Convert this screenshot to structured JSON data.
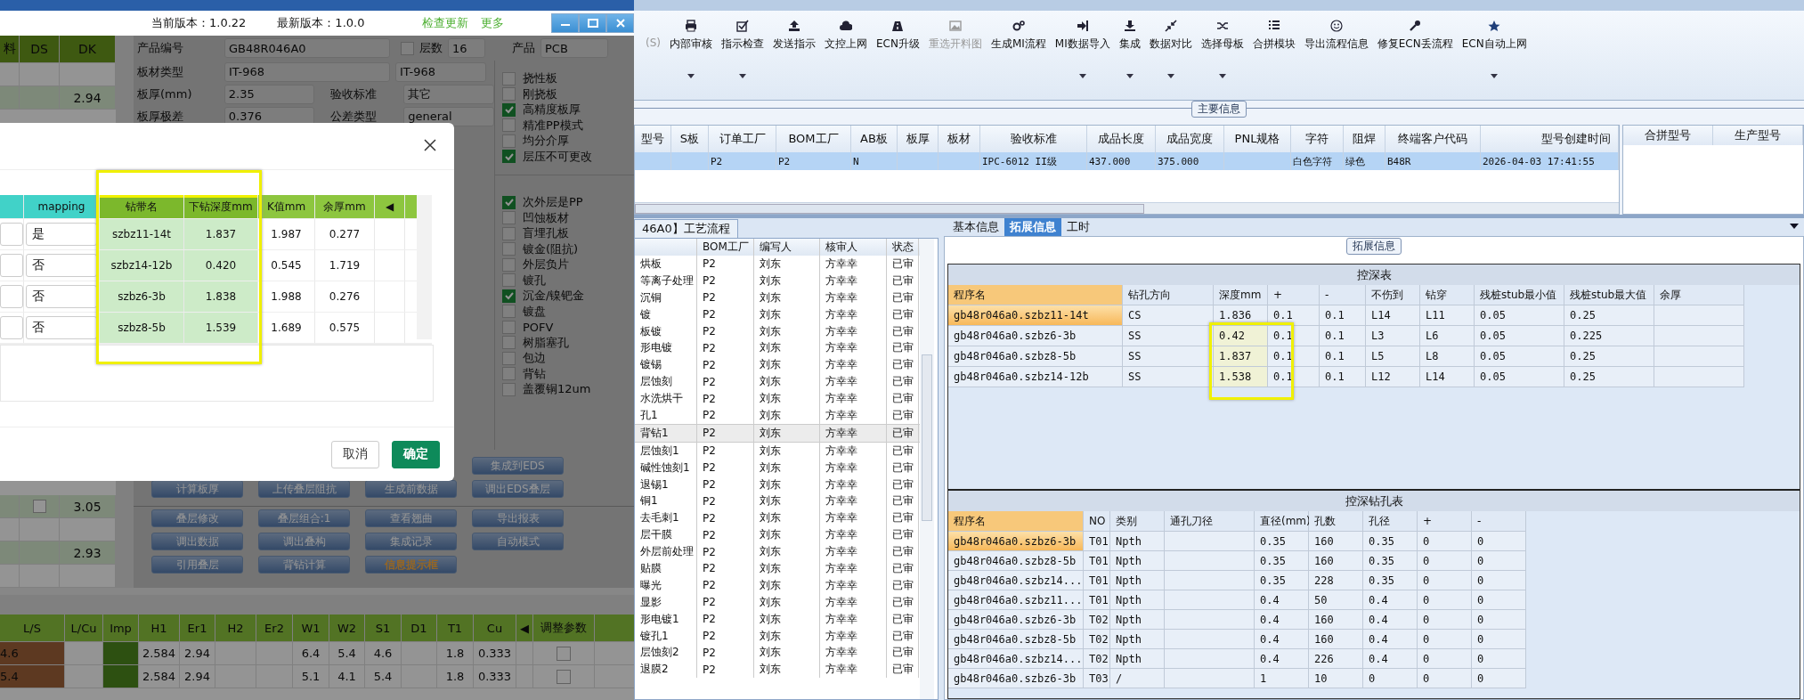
{
  "left_window": {
    "header": {
      "current_version": "当前版本：1.0.22",
      "latest_version": "最新版本：1.0.0",
      "links": [
        "检查更新",
        "更多"
      ]
    },
    "stack_table": {
      "columns": [
        "料",
        "DS",
        "DK"
      ],
      "rows_above": [
        {
          "cells": [
            "",
            "",
            ""
          ],
          "highlighted": false
        },
        {
          "cells": [
            "",
            "",
            "2.94"
          ],
          "highlighted": true
        }
      ],
      "rows_below": [
        {
          "cells": [
            "",
            "",
            "3.05"
          ],
          "highlighted": true,
          "checkbox": true
        },
        {
          "cells": [
            "",
            "",
            ""
          ],
          "highlighted": false,
          "checkbox": false
        },
        {
          "cells": [
            "",
            "",
            "2.93"
          ],
          "highlighted": true,
          "checkbox": false
        },
        {
          "cells": [
            "",
            "",
            ""
          ],
          "highlighted": false,
          "checkbox": false
        }
      ]
    },
    "form": {
      "row1": [
        {
          "label": "产品编号",
          "value": "GB48R046A0"
        },
        {
          "label": "层数",
          "value": "16",
          "checked": false
        },
        {
          "label": "产品",
          "value": "PCB"
        }
      ],
      "rows": [
        {
          "label": "板材类型",
          "value": "IT-968",
          "label2": "",
          "value2": "IT-968"
        },
        {
          "label": "板厚(mm)",
          "value": "2.35",
          "label2": "验收标准",
          "value2": "其它"
        },
        {
          "label": "板厚极差",
          "value": "0.376",
          "label2": "公差类型",
          "value2": "general"
        }
      ]
    },
    "options_top": [
      {
        "label": "挠性板",
        "checked": false
      },
      {
        "label": "刚挠板",
        "checked": false
      },
      {
        "label": "高精度板厚",
        "checked": true
      },
      {
        "label": "精准PP模式",
        "checked": false
      },
      {
        "label": "均分介厚",
        "checked": false
      },
      {
        "label": "层压不可更改",
        "checked": true
      }
    ],
    "options_bottom": [
      {
        "label": "次外层是PP",
        "checked": true
      },
      {
        "label": "凹蚀板材",
        "checked": false
      },
      {
        "label": "盲埋孔板",
        "checked": false
      },
      {
        "label": "镀金(阻抗)",
        "checked": false
      },
      {
        "label": "外层负片",
        "checked": false
      },
      {
        "label": "镀孔",
        "checked": false
      },
      {
        "label": "沉金/镍钯金",
        "checked": true
      },
      {
        "label": "镀盘",
        "checked": false
      },
      {
        "label": "POFV",
        "checked": false
      },
      {
        "label": "树脂塞孔",
        "checked": false
      },
      {
        "label": "包边",
        "checked": false
      },
      {
        "label": "背钻",
        "checked": false
      },
      {
        "label": "盖覆铜12um",
        "checked": false
      }
    ],
    "button_rows": [
      [
        {
          "label": "集成到EDS",
          "kind": "normal"
        }
      ],
      [
        {
          "label": "计算板厚",
          "kind": "normal"
        },
        {
          "label": "上传叠层阻抗",
          "kind": "normal"
        },
        {
          "label": "生成前数据",
          "kind": "normal"
        },
        {
          "label": "调出EDS叠层",
          "kind": "normal"
        }
      ],
      [
        {
          "label": "叠层修改",
          "kind": "normal"
        },
        {
          "label": "叠层组合:1",
          "kind": "normal"
        },
        {
          "label": "查看翘曲",
          "kind": "normal"
        },
        {
          "label": "导出报表",
          "kind": "normal"
        }
      ],
      [
        {
          "label": "调出数据",
          "kind": "normal"
        },
        {
          "label": "调出叠构",
          "kind": "normal"
        },
        {
          "label": "集成记录",
          "kind": "normal"
        },
        {
          "label": "自动模式",
          "kind": "normal"
        }
      ],
      [
        {
          "label": "引用叠层",
          "kind": "normal"
        },
        {
          "label": "背钻计算",
          "kind": "normal"
        },
        {
          "label": "信息提示框",
          "kind": "warning"
        }
      ]
    ],
    "impedance_table": {
      "columns": [
        "L/S",
        "L/Cu",
        "Imp",
        "H1",
        "Er1",
        "H2",
        "Er2",
        "W1",
        "W2",
        "S1",
        "D1",
        "T1",
        "Cu",
        "◀",
        "调整参数"
      ],
      "rows": [
        {
          "cells": [
            "4.6",
            "",
            "",
            "2.584",
            "2.94",
            "",
            "",
            "6.4",
            "5.4",
            "4.6",
            "",
            "1.8",
            "0.333",
            ""
          ],
          "adjust": false
        },
        {
          "cells": [
            "5.4",
            "",
            "",
            "2.584",
            "2.94",
            "",
            "",
            "5.1",
            "4.1",
            "5.4",
            "",
            "1.8",
            "0.333",
            ""
          ],
          "adjust": false
        }
      ]
    }
  },
  "dialog": {
    "columns": [
      {
        "highlighted": false
      },
      {
        "label": "mapping",
        "highlighted": false
      },
      {
        "label": "钻带名",
        "highlighted": true
      },
      {
        "label": "下钻深度mm",
        "highlighted": true
      },
      {
        "label": "K值mm",
        "highlighted": false
      },
      {
        "label": "余厚mm",
        "highlighted": false
      },
      {
        "label": "◀",
        "highlighted": false
      }
    ],
    "rows": [
      {
        "cells": [
          "",
          "是",
          "szbz11-14t",
          "1.837",
          "1.987",
          "0.277"
        ]
      },
      {
        "cells": [
          "",
          "否",
          "szbz14-12b",
          "0.420",
          "0.545",
          "1.719"
        ]
      },
      {
        "cells": [
          "",
          "否",
          "szbz6-3b",
          "1.838",
          "1.988",
          "0.276"
        ]
      },
      {
        "cells": [
          "",
          "否",
          "szbz8-5b",
          "1.539",
          "1.689",
          "0.575"
        ]
      }
    ],
    "buttons": [
      {
        "label": "取消",
        "kind": "secondary"
      },
      {
        "label": "确定",
        "kind": "primary"
      }
    ]
  },
  "toolbar": [
    {
      "label": "(S)",
      "disabled": true,
      "dropdown": false
    },
    {
      "label": "内部审核",
      "disabled": false,
      "dropdown": true
    },
    {
      "label": "指示检查",
      "disabled": false,
      "dropdown": true
    },
    {
      "label": "发送指示",
      "disabled": false,
      "dropdown": false
    },
    {
      "label": "文控上网",
      "disabled": false,
      "dropdown": false
    },
    {
      "label": "ECN升级",
      "disabled": false,
      "dropdown": false
    },
    {
      "label": "重选开料图",
      "disabled": true,
      "dropdown": false
    },
    {
      "label": "生成MI流程",
      "disabled": false,
      "dropdown": false
    },
    {
      "label": "MI数据导入",
      "disabled": false,
      "dropdown": true
    },
    {
      "label": "集成",
      "disabled": false,
      "dropdown": true
    },
    {
      "label": "数据对比",
      "disabled": false,
      "dropdown": true
    },
    {
      "label": "选择母板",
      "disabled": false,
      "dropdown": true
    },
    {
      "label": "合拼模块",
      "disabled": false,
      "dropdown": false
    },
    {
      "label": "导出流程信息",
      "disabled": false,
      "dropdown": false
    },
    {
      "label": "修复ECN丢流程",
      "disabled": false,
      "dropdown": false
    },
    {
      "label": "ECN自动上网",
      "disabled": false,
      "dropdown": true
    }
  ],
  "main_info": {
    "title": "主要信息",
    "columns": [
      "型号",
      "S板",
      "订单工厂",
      "BOM工厂",
      "AB板",
      "板厚",
      "板材",
      "验收标准",
      "成品长度",
      "成品宽度",
      "PNL规格",
      "字符",
      "阻焊",
      "终端客户代码",
      "型号创建时间"
    ],
    "rows": [
      {
        "selected": true,
        "cells": [
          "",
          "",
          "P2",
          "P2",
          "N",
          "",
          "",
          "IPC-6012 II级",
          "437.000",
          "375.000",
          "",
          "白色字符",
          "绿色",
          "B48R",
          "2026-04-03 17:41:55"
        ]
      }
    ],
    "side_columns": [
      "合拼型号",
      "生产型号"
    ]
  },
  "process_flow": {
    "tab": "46A0】工艺流程",
    "columns": [
      "",
      "BOM工厂",
      "编写人",
      "核审人",
      "状态"
    ],
    "rows": [
      {
        "selected": false,
        "cells": [
          "烘板",
          "P2",
          "刘东",
          "方幸幸",
          "已审"
        ]
      },
      {
        "selected": false,
        "cells": [
          "等离子处理",
          "P2",
          "刘东",
          "方幸幸",
          "已审"
        ]
      },
      {
        "selected": false,
        "cells": [
          "沉铜",
          "P2",
          "刘东",
          "方幸幸",
          "已审"
        ]
      },
      {
        "selected": false,
        "cells": [
          "镀",
          "P2",
          "刘东",
          "方幸幸",
          "已审"
        ]
      },
      {
        "selected": false,
        "cells": [
          "板镀",
          "P2",
          "刘东",
          "方幸幸",
          "已审"
        ]
      },
      {
        "selected": false,
        "cells": [
          "形电镀",
          "P2",
          "刘东",
          "方幸幸",
          "已审"
        ]
      },
      {
        "selected": false,
        "cells": [
          "镀锡",
          "P2",
          "刘东",
          "方幸幸",
          "已审"
        ]
      },
      {
        "selected": false,
        "cells": [
          "层蚀刻",
          "P2",
          "刘东",
          "方幸幸",
          "已审"
        ]
      },
      {
        "selected": false,
        "cells": [
          "水洗烘干",
          "P2",
          "刘东",
          "方幸幸",
          "已审"
        ]
      },
      {
        "selected": false,
        "cells": [
          "孔1",
          "P2",
          "刘东",
          "方幸幸",
          "已审"
        ]
      },
      {
        "selected": true,
        "cells": [
          "背钻1",
          "P2",
          "刘东",
          "方幸幸",
          "已审"
        ]
      },
      {
        "selected": false,
        "cells": [
          "层蚀刻1",
          "P2",
          "刘东",
          "方幸幸",
          "已审"
        ]
      },
      {
        "selected": false,
        "cells": [
          "碱性蚀刻1",
          "P2",
          "刘东",
          "方幸幸",
          "已审"
        ]
      },
      {
        "selected": false,
        "cells": [
          "退锡1",
          "P2",
          "刘东",
          "方幸幸",
          "已审"
        ]
      },
      {
        "selected": false,
        "cells": [
          "铜1",
          "P2",
          "刘东",
          "方幸幸",
          "已审"
        ]
      },
      {
        "selected": false,
        "cells": [
          "去毛刺1",
          "P2",
          "刘东",
          "方幸幸",
          "已审"
        ]
      },
      {
        "selected": false,
        "cells": [
          "层干膜",
          "P2",
          "刘东",
          "方幸幸",
          "已审"
        ]
      },
      {
        "selected": false,
        "cells": [
          "外层前处理",
          "P2",
          "刘东",
          "方幸幸",
          "已审"
        ]
      },
      {
        "selected": false,
        "cells": [
          "贴膜",
          "P2",
          "刘东",
          "方幸幸",
          "已审"
        ]
      },
      {
        "selected": false,
        "cells": [
          "曝光",
          "P2",
          "刘东",
          "方幸幸",
          "已审"
        ]
      },
      {
        "selected": false,
        "cells": [
          "显影",
          "P2",
          "刘东",
          "方幸幸",
          "已审"
        ]
      },
      {
        "selected": false,
        "cells": [
          "形电镀1",
          "P2",
          "刘东",
          "方幸幸",
          "已审"
        ]
      },
      {
        "selected": false,
        "cells": [
          "镀孔1",
          "P2",
          "刘东",
          "方幸幸",
          "已审"
        ]
      },
      {
        "selected": false,
        "cells": [
          "层蚀刻2",
          "P2",
          "刘东",
          "方幸幸",
          "已审"
        ]
      },
      {
        "selected": false,
        "cells": [
          "退膜2",
          "P2",
          "刘东",
          "方幸幸",
          "已审"
        ]
      }
    ]
  },
  "detail_tabs": [
    {
      "label": "基本信息",
      "selected": false
    },
    {
      "label": "拓展信息",
      "selected": true
    },
    {
      "label": "工时",
      "selected": false
    }
  ],
  "extended_info": {
    "title": "拓展信息",
    "depth_table": {
      "title": "控深表",
      "columns": [
        "程序名",
        "钻孔方向",
        "深度mm",
        "+",
        "-",
        "不伤到",
        "钻穿",
        "残桩stub最小值",
        "残桩stub最大值",
        "余厚"
      ],
      "rows": [
        {
          "selected": true,
          "highlighted": false,
          "cells": [
            "gb48r046a0.szbz11-14t",
            "CS",
            "1.836",
            "0.1",
            "0.1",
            "L14",
            "L11",
            "0.05",
            "0.25",
            ""
          ]
        },
        {
          "selected": false,
          "highlighted": true,
          "cells": [
            "gb48r046a0.szbz6-3b",
            "SS",
            "0.42",
            "0.1",
            "0.1",
            "L3",
            "L6",
            "0.05",
            "0.225",
            ""
          ]
        },
        {
          "selected": false,
          "highlighted": true,
          "cells": [
            "gb48r046a0.szbz8-5b",
            "SS",
            "1.837",
            "0.1",
            "0.1",
            "L5",
            "L8",
            "0.05",
            "0.25",
            ""
          ]
        },
        {
          "selected": false,
          "highlighted": true,
          "cells": [
            "gb48r046a0.szbz14-12b",
            "SS",
            "1.538",
            "0.1",
            "0.1",
            "L12",
            "L14",
            "0.05",
            "0.25",
            ""
          ]
        }
      ]
    },
    "hole_table": {
      "title": "控深钻孔表",
      "columns": [
        "程序名",
        "NO",
        "类别",
        "通孔刀径",
        "直径(mm)",
        "孔数",
        "孔径",
        "+",
        "-"
      ],
      "rows": [
        {
          "selected": true,
          "cells": [
            "gb48r046a0.szbz6-3b",
            "T01",
            "Npth",
            "",
            "0.35",
            "160",
            "0.35",
            "0",
            "0"
          ]
        },
        {
          "selected": false,
          "cells": [
            "gb48r046a0.szbz8-5b",
            "T01",
            "Npth",
            "",
            "0.35",
            "160",
            "0.35",
            "0",
            "0"
          ]
        },
        {
          "selected": false,
          "cells": [
            "gb48r046a0.szbz14...",
            "T01",
            "Npth",
            "",
            "0.35",
            "228",
            "0.35",
            "0",
            "0"
          ]
        },
        {
          "selected": false,
          "cells": [
            "gb48r046a0.szbz11...",
            "T01",
            "Npth",
            "",
            "0.4",
            "50",
            "0.4",
            "0",
            "0"
          ]
        },
        {
          "selected": false,
          "cells": [
            "gb48r046a0.szbz6-3b",
            "T02",
            "Npth",
            "",
            "0.4",
            "160",
            "0.4",
            "0",
            "0"
          ]
        },
        {
          "selected": false,
          "cells": [
            "gb48r046a0.szbz8-5b",
            "T02",
            "Npth",
            "",
            "0.4",
            "160",
            "0.4",
            "0",
            "0"
          ]
        },
        {
          "selected": false,
          "cells": [
            "gb48r046a0.szbz14...",
            "T02",
            "Npth",
            "",
            "0.4",
            "226",
            "0.4",
            "0",
            "0"
          ]
        },
        {
          "selected": false,
          "cells": [
            "gb48r046a0.szbz6-3b",
            "T03",
            "/",
            "",
            "1",
            "10",
            "0",
            "0",
            "0"
          ]
        }
      ]
    }
  }
}
